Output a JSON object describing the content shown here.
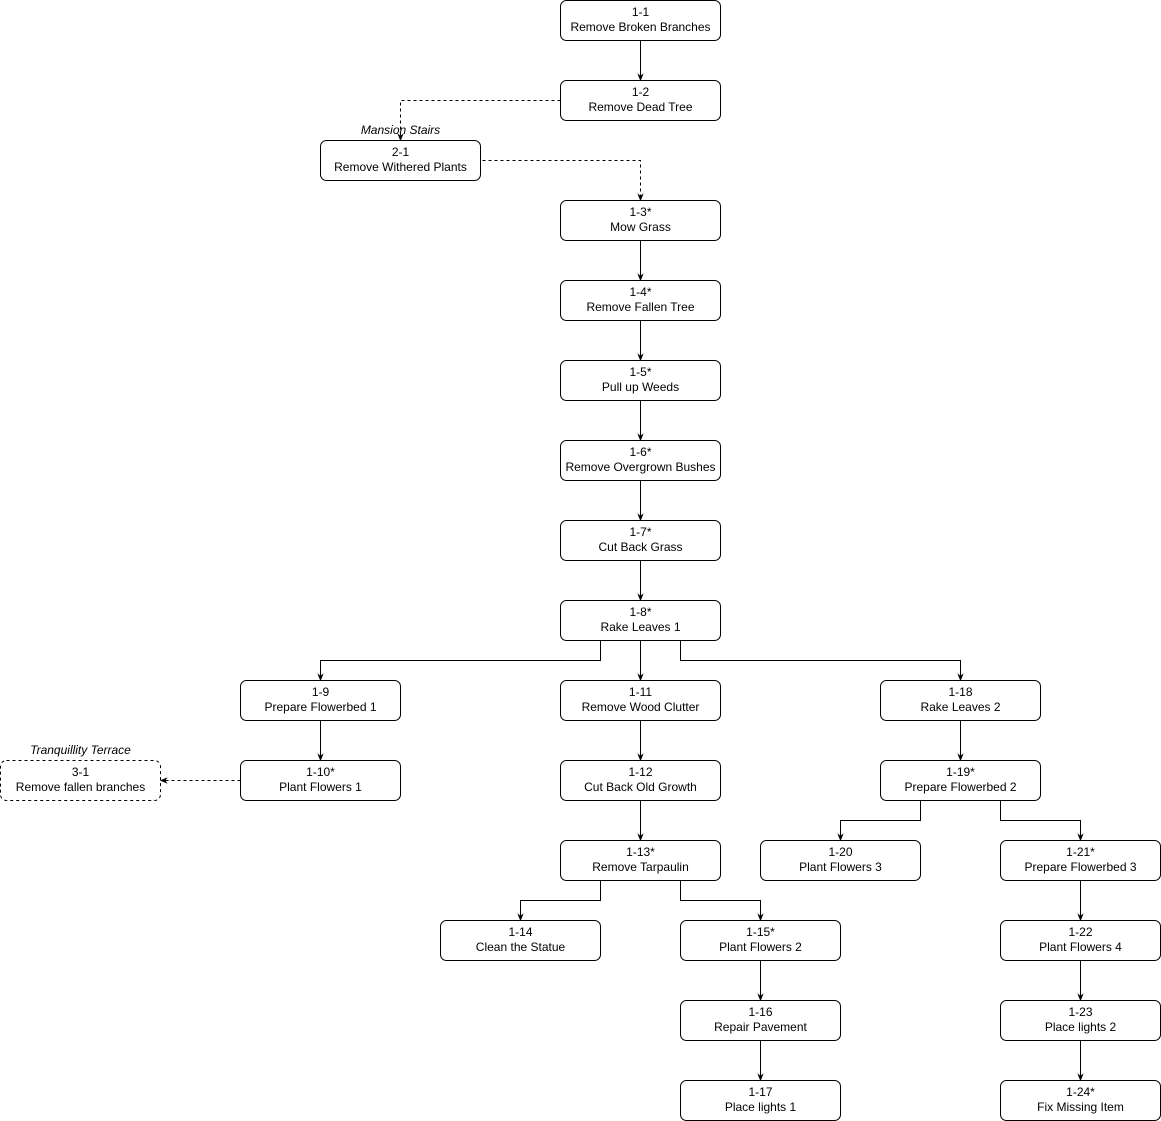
{
  "diagram": {
    "nodes": [
      {
        "id": "1-1",
        "code": "1-1",
        "label": "Remove Broken Branches"
      },
      {
        "id": "1-2",
        "code": "1-2",
        "label": "Remove Dead Tree"
      },
      {
        "id": "2-1",
        "code": "2-1",
        "label": "Remove Withered Plants",
        "group": "Mansion Stairs"
      },
      {
        "id": "1-3",
        "code": "1-3*",
        "label": "Mow Grass"
      },
      {
        "id": "1-4",
        "code": "1-4*",
        "label": "Remove Fallen Tree"
      },
      {
        "id": "1-5",
        "code": "1-5*",
        "label": "Pull up Weeds"
      },
      {
        "id": "1-6",
        "code": "1-6*",
        "label": "Remove Overgrown Bushes"
      },
      {
        "id": "1-7",
        "code": "1-7*",
        "label": "Cut Back Grass"
      },
      {
        "id": "1-8",
        "code": "1-8*",
        "label": "Rake Leaves 1"
      },
      {
        "id": "1-9",
        "code": "1-9",
        "label": "Prepare Flowerbed 1"
      },
      {
        "id": "1-11",
        "code": "1-11",
        "label": "Remove Wood Clutter"
      },
      {
        "id": "1-18",
        "code": "1-18",
        "label": "Rake Leaves 2"
      },
      {
        "id": "3-1",
        "code": "3-1",
        "label": "Remove fallen branches",
        "group": "Tranquillity Terrace",
        "dashed": true
      },
      {
        "id": "1-10",
        "code": "1-10*",
        "label": "Plant Flowers 1"
      },
      {
        "id": "1-12",
        "code": "1-12",
        "label": "Cut Back Old Growth"
      },
      {
        "id": "1-19",
        "code": "1-19*",
        "label": "Prepare Flowerbed 2"
      },
      {
        "id": "1-13",
        "code": "1-13*",
        "label": "Remove Tarpaulin"
      },
      {
        "id": "1-20",
        "code": "1-20",
        "label": "Plant Flowers 3"
      },
      {
        "id": "1-21",
        "code": "1-21*",
        "label": "Prepare Flowerbed 3"
      },
      {
        "id": "1-14",
        "code": "1-14",
        "label": "Clean the Statue"
      },
      {
        "id": "1-15",
        "code": "1-15*",
        "label": "Plant Flowers 2"
      },
      {
        "id": "1-22",
        "code": "1-22",
        "label": "Plant Flowers 4"
      },
      {
        "id": "1-16",
        "code": "1-16",
        "label": "Repair Pavement"
      },
      {
        "id": "1-23",
        "code": "1-23",
        "label": "Place lights 2"
      },
      {
        "id": "1-17",
        "code": "1-17",
        "label": "Place lights 1"
      },
      {
        "id": "1-24",
        "code": "1-24*",
        "label": "Fix Missing Item"
      }
    ],
    "edges": [
      {
        "from": "1-1",
        "to": "1-2"
      },
      {
        "from": "1-2",
        "to": "2-1",
        "dashed": true
      },
      {
        "from": "2-1",
        "to": "1-3",
        "dashed": true
      },
      {
        "from": "1-3",
        "to": "1-4"
      },
      {
        "from": "1-4",
        "to": "1-5"
      },
      {
        "from": "1-5",
        "to": "1-6"
      },
      {
        "from": "1-6",
        "to": "1-7"
      },
      {
        "from": "1-7",
        "to": "1-8"
      },
      {
        "from": "1-8",
        "to": "1-9"
      },
      {
        "from": "1-8",
        "to": "1-11"
      },
      {
        "from": "1-8",
        "to": "1-18"
      },
      {
        "from": "1-9",
        "to": "1-10"
      },
      {
        "from": "1-10",
        "to": "3-1",
        "dashed": true
      },
      {
        "from": "1-11",
        "to": "1-12"
      },
      {
        "from": "1-12",
        "to": "1-13"
      },
      {
        "from": "1-13",
        "to": "1-14"
      },
      {
        "from": "1-13",
        "to": "1-15"
      },
      {
        "from": "1-15",
        "to": "1-16"
      },
      {
        "from": "1-16",
        "to": "1-17"
      },
      {
        "from": "1-18",
        "to": "1-19"
      },
      {
        "from": "1-19",
        "to": "1-20"
      },
      {
        "from": "1-19",
        "to": "1-21"
      },
      {
        "from": "1-21",
        "to": "1-22"
      },
      {
        "from": "1-22",
        "to": "1-23"
      },
      {
        "from": "1-23",
        "to": "1-24"
      }
    ]
  }
}
